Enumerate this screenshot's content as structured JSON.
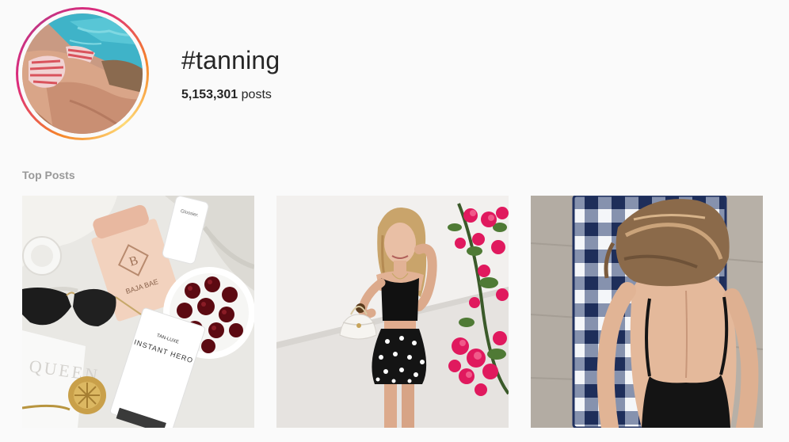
{
  "header": {
    "hashtag": "#tanning",
    "post_count": "5,153,301",
    "post_count_label": "posts"
  },
  "sections": {
    "top_posts_label": "Top Posts"
  },
  "top_posts": [
    {
      "photo": "flatlay-sunscreen-cherries",
      "printed_text": {
        "bottle_brand": "BAJA BAE",
        "bottle_monogram": "B",
        "tube_brand": "TAN-LUXE",
        "tube_product": "INSTANT HERO",
        "magazine_text": "QUEEN",
        "small_bottle": "Glossier."
      }
    },
    {
      "photo": "woman-polka-dot-skirt-bougainvillea"
    },
    {
      "photo": "woman-tanning-on-checkered-lounger"
    }
  ],
  "colors": {
    "background": "#fafafa",
    "text_primary": "#262626",
    "text_muted": "#999999",
    "story_ring_start": "#f58529",
    "story_ring_end": "#dd2a7b"
  }
}
